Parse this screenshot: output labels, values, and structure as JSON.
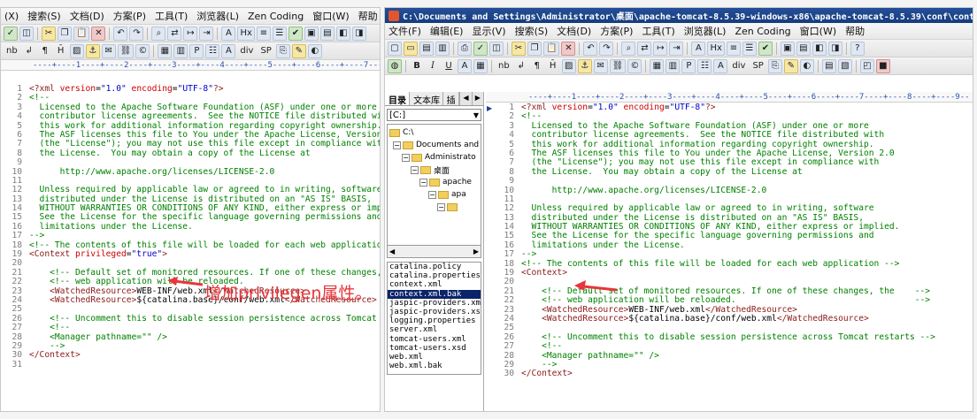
{
  "left_window": {
    "menu": [
      "(X)",
      "搜索(S)",
      "文档(D)",
      "方案(P)",
      "工具(T)",
      "浏览器(L)",
      "Zen Coding",
      "窗口(W)",
      "帮助"
    ],
    "ruler": "----+----1----+----2----+----3----+----4----+----5----+----6----+----7----+----8",
    "annotation": "增加privilegen属性。"
  },
  "right_window": {
    "title": "C:\\Documents and Settings\\Administrator\\桌面\\apache-tomcat-8.5.39-windows-x86\\apache-tomcat-8.5.39\\conf\\context.x...",
    "menu": [
      "文件(F)",
      "编辑(E)",
      "显示(V)",
      "搜索(S)",
      "文档(D)",
      "方案(P)",
      "工具(T)",
      "浏览器(L)",
      "Zen Coding",
      "窗口(W)",
      "帮助"
    ],
    "ruler": "----+----1----+----2----+----3----+----4----+----5----+----6----+----7----+----8----+----9--",
    "sidebar": {
      "tabs": [
        "目录",
        "文本库",
        "插"
      ],
      "drive": "[C:]",
      "tree": [
        "C:\\",
        "Documents and Se",
        "Administrato",
        "桌面",
        "apache",
        "apa"
      ],
      "files": [
        "catalina.policy",
        "catalina.properties",
        "context.xml",
        "context.xml.bak",
        "jaspic-providers.xml",
        "jaspic-providers.xsd",
        "logging.properties",
        "server.xml",
        "tomcat-users.xml",
        "tomcat-users.xsd",
        "web.xml",
        "web.xml.bak"
      ],
      "selected_file_index": 3
    }
  },
  "left_code": [
    [
      [
        "t-tag",
        "<?xml "
      ],
      [
        "t-att",
        "version"
      ],
      [
        "t-txt",
        "="
      ],
      [
        "t-val",
        "\"1.0\""
      ],
      [
        "t-txt",
        " "
      ],
      [
        "t-att",
        "encoding"
      ],
      [
        "t-txt",
        "="
      ],
      [
        "t-val",
        "\"UTF-8\""
      ],
      [
        "t-tag",
        "?>"
      ]
    ],
    [
      [
        "t-com",
        "<!--"
      ]
    ],
    [
      [
        "t-com",
        "  Licensed to the Apache Software Foundation (ASF) under one or more"
      ]
    ],
    [
      [
        "t-com",
        "  contributor license agreements.  See the NOTICE file distributed with"
      ]
    ],
    [
      [
        "t-com",
        "  this work for additional information regarding copyright ownership."
      ]
    ],
    [
      [
        "t-com",
        "  The ASF licenses this file to You under the Apache License, Version 2."
      ]
    ],
    [
      [
        "t-com",
        "  (the \"License\"); you may not use this file except in compliance with"
      ]
    ],
    [
      [
        "t-com",
        "  the License.  You may obtain a copy of the License at"
      ]
    ],
    [
      [
        "t-com",
        ""
      ]
    ],
    [
      [
        "t-com",
        "      http://www.apache.org/licenses/LICENSE-2.0"
      ]
    ],
    [
      [
        "t-com",
        ""
      ]
    ],
    [
      [
        "t-com",
        "  Unless required by applicable law or agreed to in writing, software"
      ]
    ],
    [
      [
        "t-com",
        "  distributed under the License is distributed on an \"AS IS\" BASIS,"
      ]
    ],
    [
      [
        "t-com",
        "  WITHOUT WARRANTIES OR CONDITIONS OF ANY KIND, either express or implie"
      ]
    ],
    [
      [
        "t-com",
        "  See the License for the specific language governing permissions and"
      ]
    ],
    [
      [
        "t-com",
        "  limitations under the License."
      ]
    ],
    [
      [
        "t-com",
        "-->"
      ]
    ],
    [
      [
        "t-com",
        "<!-- The contents of this file will be loaded for each web application -"
      ]
    ],
    [
      [
        "t-tag",
        "<Context "
      ],
      [
        "t-att",
        "privileged"
      ],
      [
        "t-txt",
        "="
      ],
      [
        "t-val",
        "\"true\""
      ],
      [
        "t-tag",
        ">"
      ]
    ],
    [
      [
        "t-com",
        ""
      ]
    ],
    [
      [
        "t-com",
        "    <!-- Default set of monitored resources. If one of these changes, th"
      ]
    ],
    [
      [
        "t-com",
        "    <!-- web application will be reloaded."
      ]
    ],
    [
      [
        "t-txt",
        "    "
      ],
      [
        "t-tag",
        "<WatchedResource>"
      ],
      [
        "t-txt",
        "WEB-INF/web.xml"
      ],
      [
        "t-tag",
        "</WatchedResource>"
      ]
    ],
    [
      [
        "t-txt",
        "    "
      ],
      [
        "t-tag",
        "<WatchedResource>"
      ],
      [
        "t-txt",
        "${catalina.base}/conf/web.xml"
      ],
      [
        "t-tag",
        "</WatchedResource>"
      ]
    ],
    [
      [
        "t-com",
        ""
      ]
    ],
    [
      [
        "t-com",
        "    <!-- Uncomment this to disable session persistence across Tomcat res"
      ]
    ],
    [
      [
        "t-com",
        "    <!--"
      ]
    ],
    [
      [
        "t-com",
        "    <Manager pathname=\"\" />"
      ]
    ],
    [
      [
        "t-com",
        "    -->"
      ]
    ],
    [
      [
        "t-tag",
        "</Context>"
      ]
    ],
    [
      [
        "t-com",
        ""
      ]
    ]
  ],
  "right_code": [
    [
      [
        "t-tag",
        "<?xml "
      ],
      [
        "t-att",
        "version"
      ],
      [
        "t-txt",
        "="
      ],
      [
        "t-val",
        "\"1.0\""
      ],
      [
        "t-txt",
        " "
      ],
      [
        "t-att",
        "encoding"
      ],
      [
        "t-txt",
        "="
      ],
      [
        "t-val",
        "\"UTF-8\""
      ],
      [
        "t-tag",
        "?>"
      ]
    ],
    [
      [
        "t-com",
        "<!--"
      ]
    ],
    [
      [
        "t-com",
        "  Licensed to the Apache Software Foundation (ASF) under one or more"
      ]
    ],
    [
      [
        "t-com",
        "  contributor license agreements.  See the NOTICE file distributed with"
      ]
    ],
    [
      [
        "t-com",
        "  this work for additional information regarding copyright ownership."
      ]
    ],
    [
      [
        "t-com",
        "  The ASF licenses this file to You under the Apache License, Version 2.0"
      ]
    ],
    [
      [
        "t-com",
        "  (the \"License\"); you may not use this file except in compliance with"
      ]
    ],
    [
      [
        "t-com",
        "  the License.  You may obtain a copy of the License at"
      ]
    ],
    [
      [
        "t-com",
        ""
      ]
    ],
    [
      [
        "t-com",
        "      http://www.apache.org/licenses/LICENSE-2.0"
      ]
    ],
    [
      [
        "t-com",
        ""
      ]
    ],
    [
      [
        "t-com",
        "  Unless required by applicable law or agreed to in writing, software"
      ]
    ],
    [
      [
        "t-com",
        "  distributed under the License is distributed on an \"AS IS\" BASIS,"
      ]
    ],
    [
      [
        "t-com",
        "  WITHOUT WARRANTIES OR CONDITIONS OF ANY KIND, either express or implied."
      ]
    ],
    [
      [
        "t-com",
        "  See the License for the specific language governing permissions and"
      ]
    ],
    [
      [
        "t-com",
        "  limitations under the License."
      ]
    ],
    [
      [
        "t-com",
        "-->"
      ]
    ],
    [
      [
        "t-com",
        "<!-- The contents of this file will be loaded for each web application -->"
      ]
    ],
    [
      [
        "t-tag",
        "<Context>"
      ]
    ],
    [
      [
        "t-com",
        ""
      ]
    ],
    [
      [
        "t-com",
        "    <!-- Default set of monitored resources. If one of these changes, the    -->"
      ]
    ],
    [
      [
        "t-com",
        "    <!-- web application will be reloaded.                                   -->"
      ]
    ],
    [
      [
        "t-txt",
        "    "
      ],
      [
        "t-tag",
        "<WatchedResource>"
      ],
      [
        "t-txt",
        "WEB-INF/web.xml"
      ],
      [
        "t-tag",
        "</WatchedResource>"
      ]
    ],
    [
      [
        "t-txt",
        "    "
      ],
      [
        "t-tag",
        "<WatchedResource>"
      ],
      [
        "t-txt",
        "${catalina.base}/conf/web.xml"
      ],
      [
        "t-tag",
        "</WatchedResource>"
      ]
    ],
    [
      [
        "t-com",
        ""
      ]
    ],
    [
      [
        "t-com",
        "    <!-- Uncomment this to disable session persistence across Tomcat restarts -->"
      ]
    ],
    [
      [
        "t-com",
        "    <!--"
      ]
    ],
    [
      [
        "t-com",
        "    <Manager pathname=\"\" />"
      ]
    ],
    [
      [
        "t-com",
        "    -->"
      ]
    ],
    [
      [
        "t-tag",
        "</Context>"
      ]
    ]
  ],
  "colors": {
    "annotation": "#e8363a",
    "titlebar": "#1e4a92",
    "selection": "#0a246a"
  }
}
